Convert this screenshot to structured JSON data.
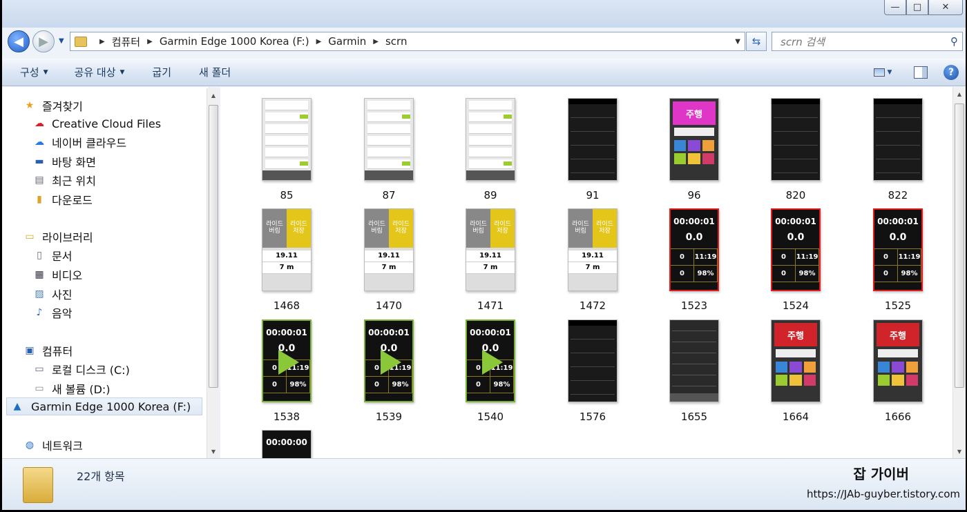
{
  "window": {
    "controls": {
      "minimize": "—",
      "maximize": "□",
      "close": "✕"
    }
  },
  "address": {
    "crumbs": [
      "컴퓨터",
      "Garmin Edge 1000 Korea (F:)",
      "Garmin",
      "scrn"
    ],
    "search_placeholder": "scrn 검색"
  },
  "toolbar": {
    "organize": "구성",
    "share": "공유 대상",
    "burn": "굽기",
    "new_folder": "새 폴더"
  },
  "sidebar": {
    "favorites_header": "즐겨찾기",
    "favorites": [
      "Creative Cloud Files",
      "네이버 클라우드",
      "바탕 화면",
      "최근 위치",
      "다운로드"
    ],
    "libraries_header": "라이브러리",
    "libraries": [
      "문서",
      "비디오",
      "사진",
      "음악"
    ],
    "computer_header": "컴퓨터",
    "drives": [
      "로컬 디스크 (C:)",
      "새 볼륨 (D:)",
      "Garmin Edge 1000 Korea (F:)"
    ],
    "network_header": "네트워크",
    "selected": "Garmin Edge 1000 Korea (F:)"
  },
  "files": [
    {
      "name": "85",
      "style": "light"
    },
    {
      "name": "87",
      "style": "light"
    },
    {
      "name": "89",
      "style": "light"
    },
    {
      "name": "91",
      "style": "dark"
    },
    {
      "name": "96",
      "style": "menu-pink"
    },
    {
      "name": "820",
      "style": "dark"
    },
    {
      "name": "822",
      "style": "dark"
    },
    {
      "name": "1468",
      "style": "ride"
    },
    {
      "name": "1470",
      "style": "ride"
    },
    {
      "name": "1471",
      "style": "ride"
    },
    {
      "name": "1472",
      "style": "ride"
    },
    {
      "name": "1523",
      "style": "timer-red"
    },
    {
      "name": "1524",
      "style": "timer-red"
    },
    {
      "name": "1525",
      "style": "timer-red"
    },
    {
      "name": "1538",
      "style": "timer-green"
    },
    {
      "name": "1539",
      "style": "timer-green"
    },
    {
      "name": "1540",
      "style": "timer-green"
    },
    {
      "name": "1576",
      "style": "dark"
    },
    {
      "name": "1655",
      "style": "list"
    },
    {
      "name": "1664",
      "style": "menu-red"
    },
    {
      "name": "1666",
      "style": "menu-red"
    },
    {
      "name": "",
      "style": "timer-plain"
    }
  ],
  "status": {
    "item_count": "22개 항목"
  },
  "watermark": {
    "title": "잡 가이버",
    "url": "https://JAb-guyber.tistory.com"
  }
}
